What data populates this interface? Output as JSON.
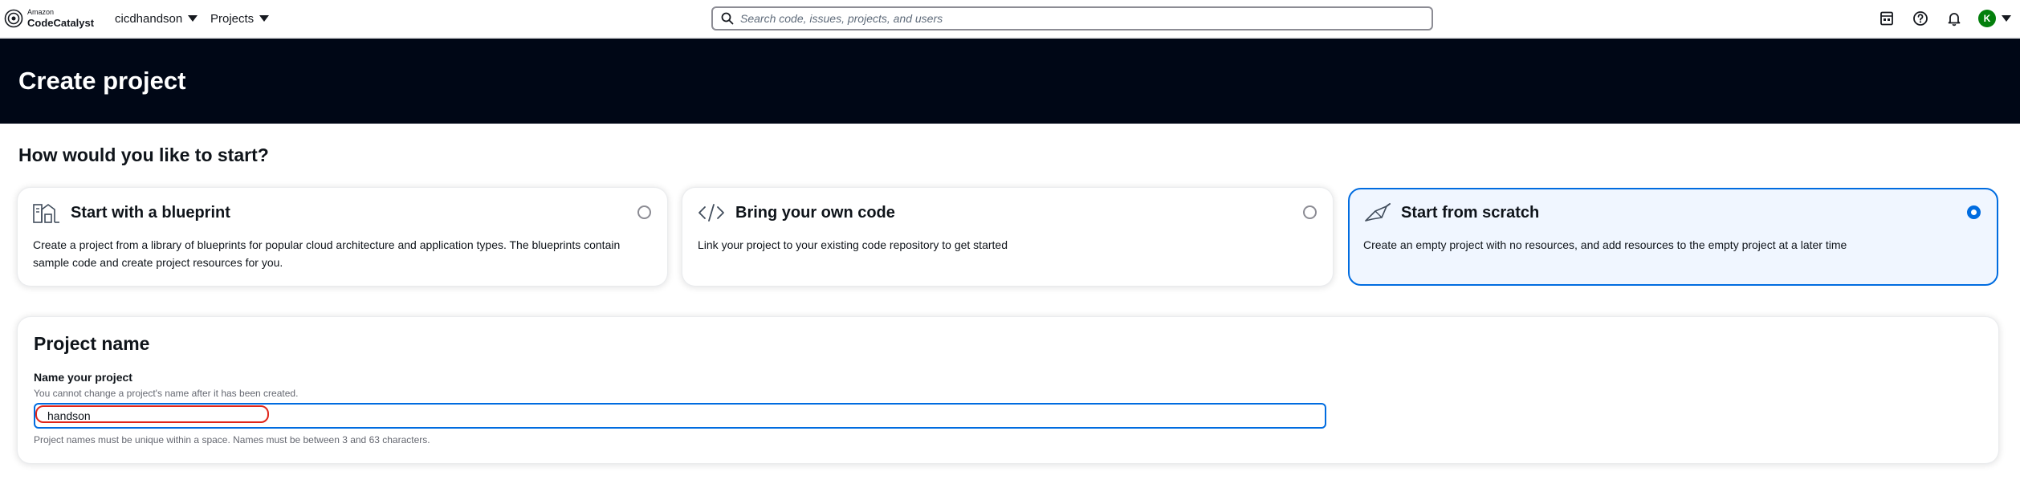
{
  "brand": {
    "small": "Amazon",
    "big": "CodeCatalyst"
  },
  "nav": {
    "space_label": "cicdhandson",
    "projects_label": "Projects",
    "search_placeholder": "Search code, issues, projects, and users",
    "avatar_initial": "K"
  },
  "header": {
    "title": "Create project"
  },
  "start": {
    "heading": "How would you like to start?",
    "options": [
      {
        "title": "Start with a blueprint",
        "description": "Create a project from a library of blueprints for popular cloud architecture and application types. The blueprints contain sample code and create project resources for you.",
        "selected": false,
        "icon": "blueprint-icon"
      },
      {
        "title": "Bring your own code",
        "description": "Link your project to your existing code repository to get started",
        "selected": false,
        "icon": "code-icon"
      },
      {
        "title": "Start from scratch",
        "description": "Create an empty project with no resources, and add resources to the empty project at a later time",
        "selected": true,
        "icon": "trowel-icon"
      }
    ]
  },
  "project_name": {
    "heading": "Project name",
    "label": "Name your project",
    "description": "You cannot change a project's name after it has been created.",
    "value": "handson",
    "constraint": "Project names must be unique within a space. Names must be between 3 and 63 characters."
  },
  "colors": {
    "header_bg": "#000716",
    "accent": "#006ce0",
    "selected_tile_bg": "#f0f6ff",
    "highlight_ring": "#e0261a",
    "avatar_bg": "#037f0c"
  }
}
